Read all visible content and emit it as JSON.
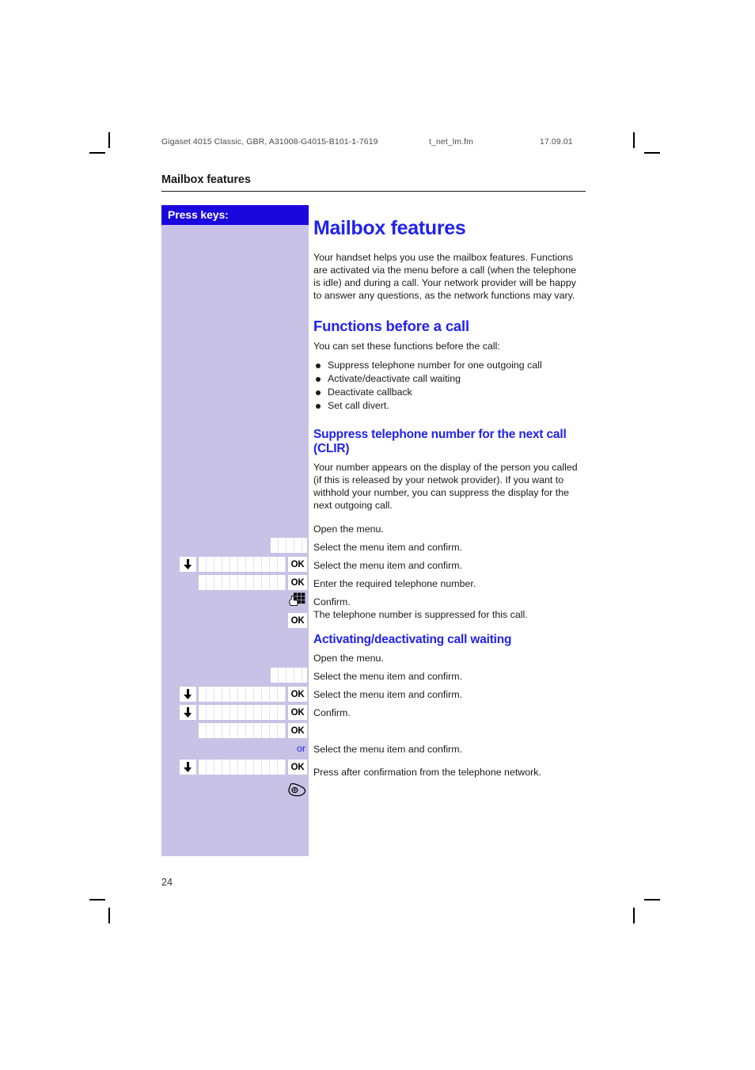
{
  "header": {
    "doc_ref": "Gigaset 4015 Classic, GBR, A31008-G4015-B101-1-7619",
    "file_name": "t_net_lm.fm",
    "doc_date": "17.09.01"
  },
  "running_head": "Mailbox features",
  "sidebar": {
    "title": "Press keys:"
  },
  "main": {
    "title": "Mailbox features",
    "intro": "Your handset helps you use the mailbox features. Functions are activated via the menu before a call (when the telephone is idle) and during a call. Your network provider will be happy to answer any questions, as the network functions may vary.",
    "section1": {
      "heading": "Functions before a call",
      "lead": "You can set these functions before the call:",
      "bullets": [
        "Suppress telephone number for one outgoing call",
        "Activate/deactivate call waiting",
        "Deactivate callback",
        "Set call divert."
      ]
    },
    "section2": {
      "heading": "Suppress telephone number for the next call (CLIR)",
      "body": "Your number appears on the display of the person you called (if this is released by your netwok provider). If you want to withhold your number, you can suppress the display for the next outgoing call.",
      "steps": [
        {
          "text": "Open the menu.",
          "keys": [
            "field-short"
          ]
        },
        {
          "text": "Select the menu item and confirm.",
          "keys": [
            "arrow-down",
            "field-long",
            "ok"
          ]
        },
        {
          "text": "Select the menu item and confirm.",
          "keys": [
            "field-long",
            "ok"
          ]
        },
        {
          "text": "Enter the required telephone number.",
          "keys": [
            "keypad"
          ]
        },
        {
          "text": "Confirm.",
          "text2": "The telephone number is suppressed for this call.",
          "keys": [
            "ok"
          ]
        }
      ]
    },
    "section3": {
      "heading": "Activating/deactivating call waiting",
      "or_label": "or",
      "steps": [
        {
          "text": "Open the menu.",
          "keys": [
            "field-short"
          ]
        },
        {
          "text": "Select the menu item and confirm.",
          "keys": [
            "arrow-down",
            "field-long",
            "ok"
          ]
        },
        {
          "text": "Select the menu item and confirm.",
          "keys": [
            "arrow-down",
            "field-long",
            "ok"
          ]
        },
        {
          "text": "Confirm.",
          "keys": [
            "field-long",
            "ok"
          ]
        },
        {
          "text": "Select the menu item and confirm.",
          "keys": [
            "arrow-down",
            "field-long",
            "ok"
          ]
        },
        {
          "text": "Press after confirmation from the telephone network.",
          "keys": [
            "handset"
          ]
        }
      ]
    }
  },
  "footer": {
    "page_number": "24"
  },
  "colors": {
    "heading_blue": "#2222ee",
    "sidebar_bar": "#1a07dd",
    "sidebar_body": "#c8c2e6"
  }
}
